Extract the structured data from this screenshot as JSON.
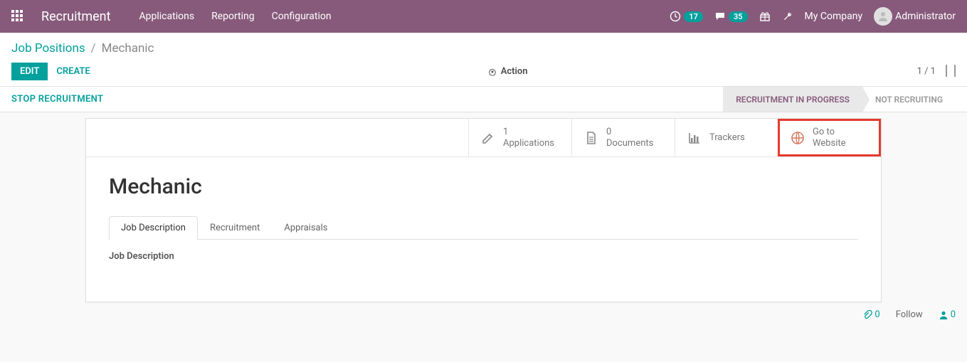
{
  "navbar": {
    "brand": "Recruitment",
    "menus": [
      "Applications",
      "Reporting",
      "Configuration"
    ],
    "timer_badge": "17",
    "discuss_badge": "35",
    "company": "My Company",
    "user": "Administrator"
  },
  "breadcrumb": {
    "parent": "Job Positions",
    "sep": "/",
    "current": "Mechanic"
  },
  "buttons": {
    "edit": "EDIT",
    "create": "CREATE",
    "action": "Action",
    "stop_recruitment": "STOP RECRUITMENT"
  },
  "pager": {
    "text": "1 / 1"
  },
  "statuses": {
    "active": "RECRUITMENT IN PROGRESS",
    "inactive": "NOT RECRUITING"
  },
  "stat_buttons": {
    "applications": {
      "count": "1",
      "label": "Applications"
    },
    "documents": {
      "count": "0",
      "label": "Documents"
    },
    "trackers": {
      "label": "Trackers"
    },
    "website": {
      "line1": "Go to",
      "line2": "Website"
    }
  },
  "record": {
    "title": "Mechanic"
  },
  "tabs": {
    "t1": "Job Description",
    "t2": "Recruitment",
    "t3": "Appraisals"
  },
  "tab_content": {
    "field_label": "Job Description"
  },
  "chatter": {
    "attach": "0",
    "follow": "Follow",
    "followers": "0"
  }
}
